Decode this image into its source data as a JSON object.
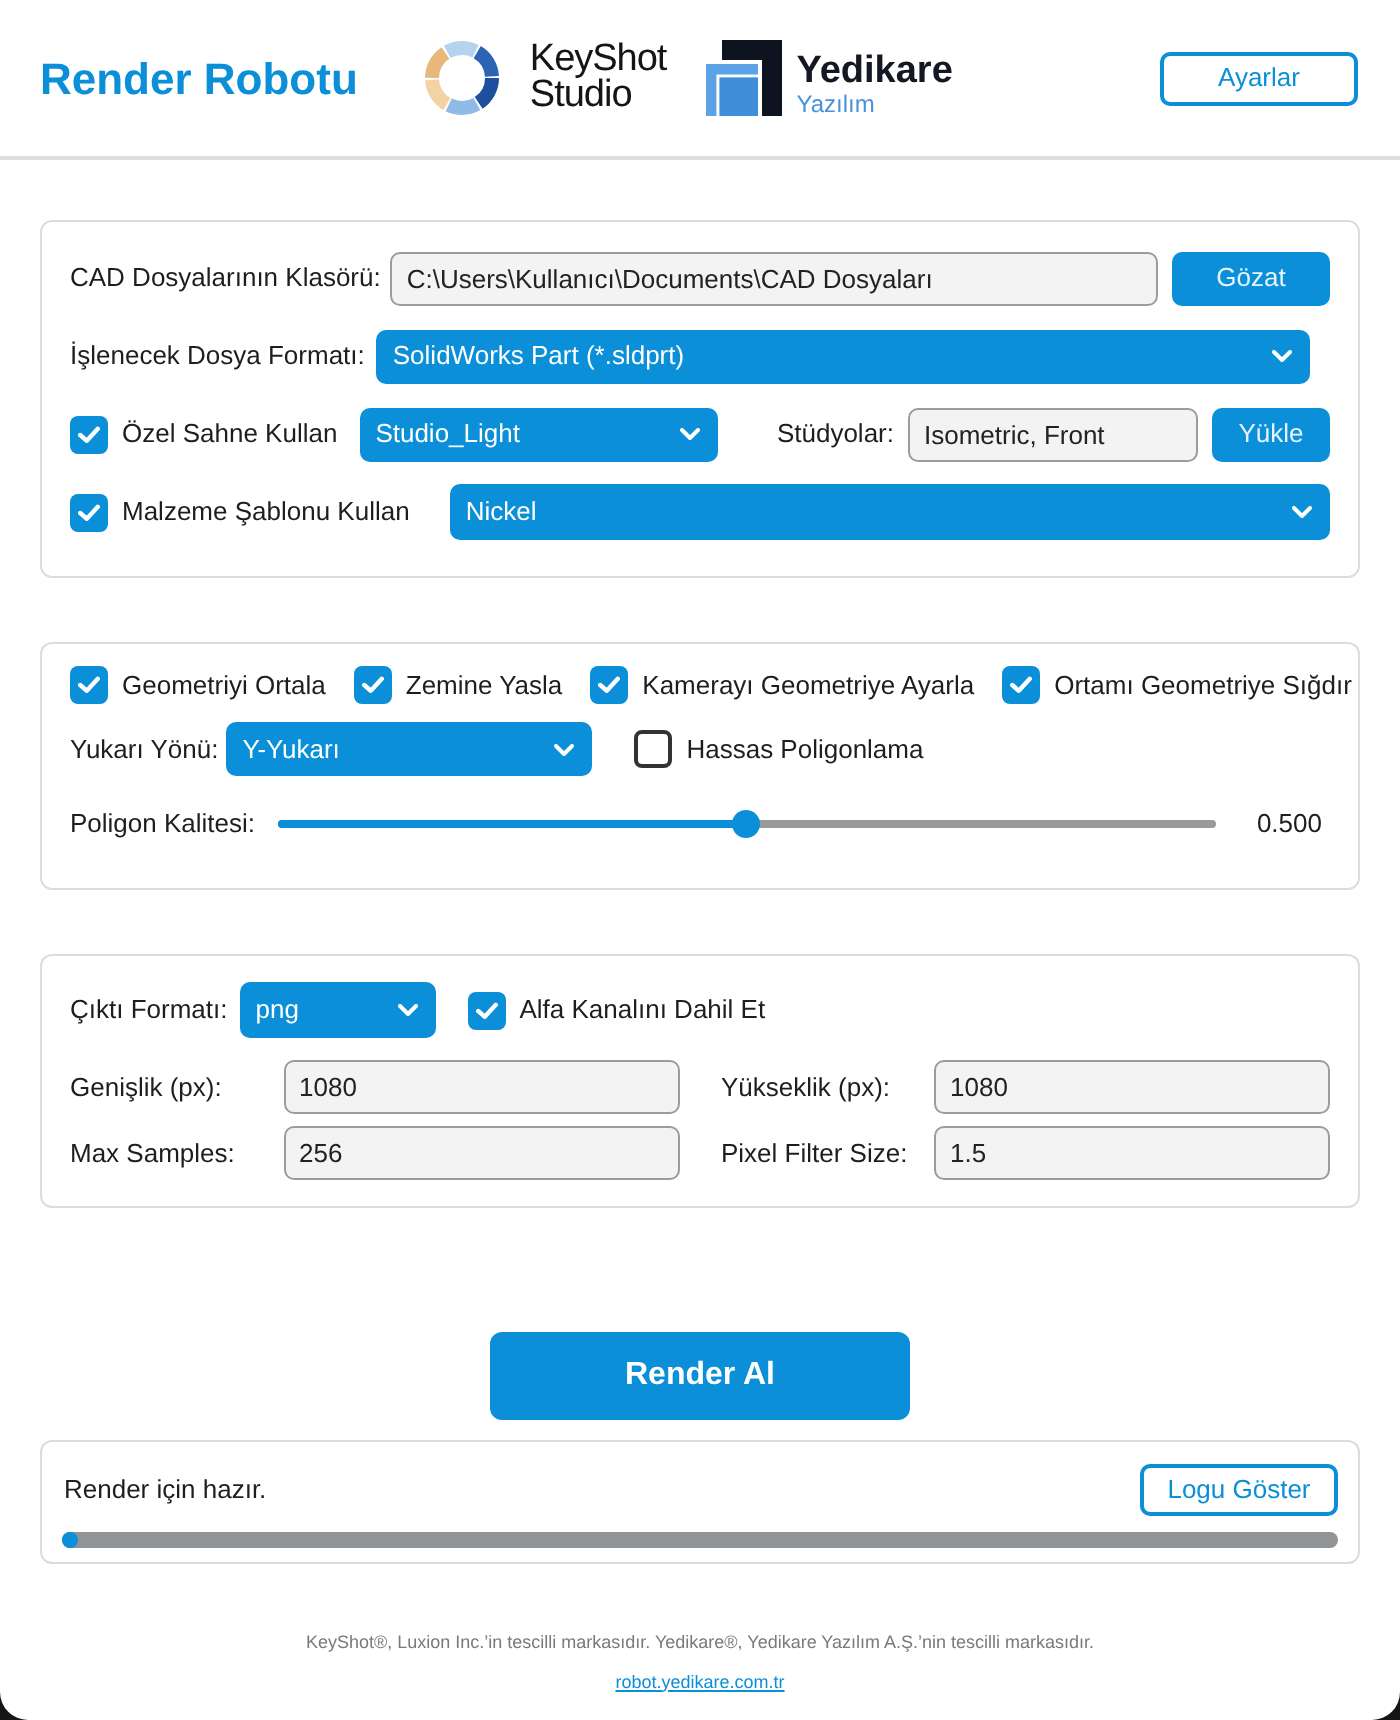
{
  "header": {
    "title": "Render Robotu",
    "keyshot_logo": {
      "line_1": "KeyShot",
      "line_2": "Studio"
    },
    "yedikare_logo": {
      "name": "Yedikare",
      "subtitle": "Yazılım"
    },
    "settings_button": "Ayarlar"
  },
  "source_panel": {
    "folder": {
      "label": "CAD Dosyalarının Klasörü:",
      "value": "C:\\Users\\Kullanıcı\\Documents\\CAD Dosyaları",
      "button": "Gözat"
    },
    "format": {
      "label": "İşlenecek Dosya Formatı:",
      "value": "SolidWorks Part (*.sldprt)"
    },
    "scene": {
      "label": "Özel Sahne Kullan",
      "checked": true,
      "value": "Studio_Light"
    },
    "studios": {
      "label": "Stüdyolar:",
      "value": "Isometric, Front",
      "button": "Yükle"
    },
    "material": {
      "label": "Malzeme Şablonu Kullan",
      "checked": true,
      "value": "Nickel"
    }
  },
  "geometry_panel": {
    "options": [
      {
        "label": "Geometriyi Ortala",
        "checked": true
      },
      {
        "label": "Zemine Yasla",
        "checked": true
      },
      {
        "label": "Kamerayı Geometriye Ayarla",
        "checked": true
      },
      {
        "label": "Ortamı Geometriye Sığdır",
        "checked": true
      }
    ],
    "up_axis": {
      "label": "Yukarı Yönü:",
      "value": "Y-Yukarı"
    },
    "precise": {
      "label": "Hassas Poligonlama",
      "checked": false
    },
    "quality": {
      "label": "Poligon Kalitesi:",
      "level": 0.5,
      "reading": "0.500"
    }
  },
  "output_panel": {
    "format": {
      "label": "Çıktı Formatı:",
      "value": "png"
    },
    "alpha": {
      "label": "Alfa Kanalını Dahil Et",
      "checked": true
    },
    "fields": [
      {
        "label": "Genişlik (px):",
        "value": "1080"
      },
      {
        "label": "Yükseklik (px):",
        "value": "1080"
      },
      {
        "label": "Max Samples:",
        "value": "256"
      },
      {
        "label": "Pixel Filter Size:",
        "value": "1.5"
      }
    ]
  },
  "render_button": "Render Al",
  "status_panel": {
    "message": "Render için hazır.",
    "log_button": "Logu Göster",
    "progress": {
      "level": 0.012
    }
  },
  "footer": {
    "notice": "KeyShot®, Luxion Inc.’in tescilli markasıdır. Yedikare®, Yedikare Yazılım A.Ş.’nin tescilli markasıdır.",
    "link": "robot.yedikare.com.tr"
  }
}
